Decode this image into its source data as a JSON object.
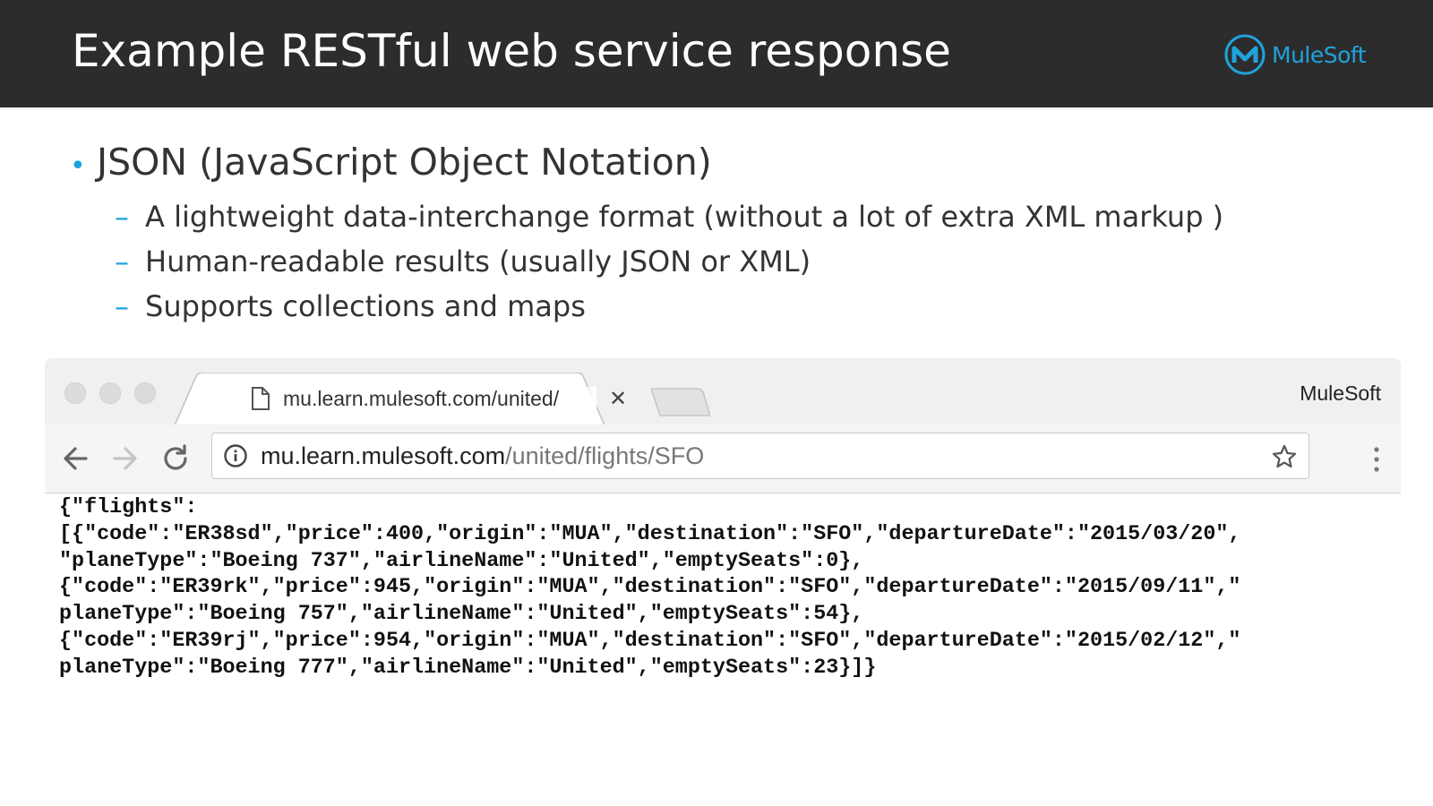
{
  "slide": {
    "title": "Example RESTful web service response",
    "brand": "MuleSoft",
    "accent_color": "#1fa3dc",
    "header_bg": "#2c2c2c"
  },
  "bullets": {
    "main": "JSON (JavaScript Object Notation)",
    "subs": [
      "A lightweight data-interchange format (without a lot of extra XML markup )",
      "Human-readable results (usually JSON or XML)",
      "Supports collections and maps"
    ]
  },
  "browser": {
    "tab_title": "mu.learn.mulesoft.com/united/",
    "tab_close_icon": "close-icon",
    "user_label": "MuleSoft",
    "url_host": "mu.learn.mulesoft.com",
    "url_path": "/united/flights/SFO",
    "icons": [
      "back-arrow-icon",
      "forward-arrow-icon",
      "reload-icon",
      "info-icon",
      "star-icon",
      "menu-dots-icon",
      "page-icon"
    ]
  },
  "response": {
    "lines": [
      "{\"flights\":",
      "[{\"code\":\"ER38sd\",\"price\":400,\"origin\":\"MUA\",\"destination\":\"SFO\",\"departureDate\":\"2015/03/20\",",
      "\"planeType\":\"Boeing 737\",\"airlineName\":\"United\",\"emptySeats\":0},",
      "{\"code\":\"ER39rk\",\"price\":945,\"origin\":\"MUA\",\"destination\":\"SFO\",\"departureDate\":\"2015/09/11\",\"",
      "planeType\":\"Boeing 757\",\"airlineName\":\"United\",\"emptySeats\":54},",
      "{\"code\":\"ER39rj\",\"price\":954,\"origin\":\"MUA\",\"destination\":\"SFO\",\"departureDate\":\"2015/02/12\",\"",
      "planeType\":\"Boeing 777\",\"airlineName\":\"United\",\"emptySeats\":23}]}"
    ]
  }
}
